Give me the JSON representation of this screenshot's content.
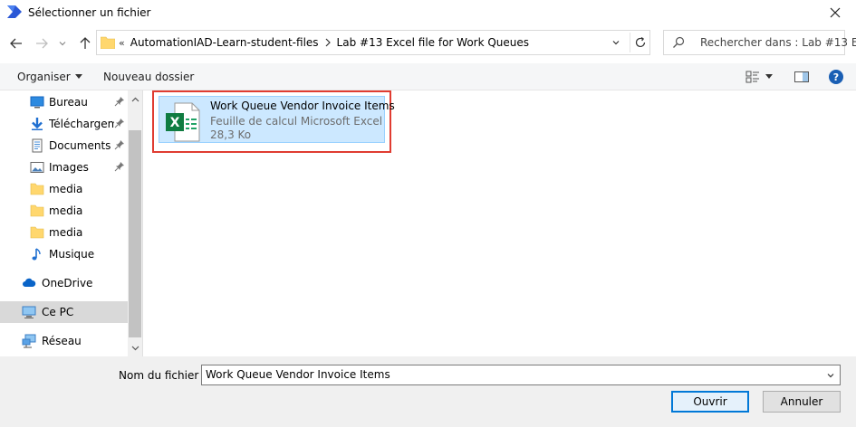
{
  "window": {
    "title": "Sélectionner un fichier"
  },
  "address": {
    "overflow": "«",
    "crumbs": [
      "AutomationIAD-Learn-student-files",
      "Lab #13 Excel file for Work Queues"
    ]
  },
  "search": {
    "placeholder": "Rechercher dans : Lab #13 E..."
  },
  "toolbar": {
    "organize_label": "Organiser",
    "new_folder_label": "Nouveau dossier"
  },
  "nav": {
    "items": [
      {
        "label": "Bureau",
        "icon": "desktop-icon",
        "pinned": true
      },
      {
        "label": "Téléchargements",
        "icon": "download-icon",
        "pinned": true
      },
      {
        "label": "Documents",
        "icon": "documents-icon",
        "pinned": true
      },
      {
        "label": "Images",
        "icon": "images-icon",
        "pinned": true
      },
      {
        "label": "media",
        "icon": "folder-icon",
        "pinned": false
      },
      {
        "label": "media",
        "icon": "folder-icon",
        "pinned": false
      },
      {
        "label": "media",
        "icon": "folder-icon",
        "pinned": false
      },
      {
        "label": "Musique",
        "icon": "music-icon",
        "pinned": false
      },
      {
        "label": "OneDrive",
        "icon": "cloud-icon",
        "pinned": false
      },
      {
        "label": "Ce PC",
        "icon": "computer-icon",
        "pinned": false,
        "selected": true
      },
      {
        "label": "Réseau",
        "icon": "network-icon",
        "pinned": false
      }
    ]
  },
  "files": [
    {
      "name": "Work Queue Vendor Invoice Items",
      "type": "Feuille de calcul Microsoft Excel",
      "size": "28,3 Ko",
      "icon": "excel-file-icon"
    }
  ],
  "footer": {
    "filename_label": "Nom du fichier :",
    "filename_value": "Work Queue Vendor Invoice Items",
    "open_label": "Ouvrir",
    "cancel_label": "Annuler"
  },
  "colors": {
    "accent": "#0078d7",
    "selection": "#cce8ff",
    "highlight": "#e03c31",
    "excel_green": "#107c41",
    "folder": "#ffd76e"
  }
}
